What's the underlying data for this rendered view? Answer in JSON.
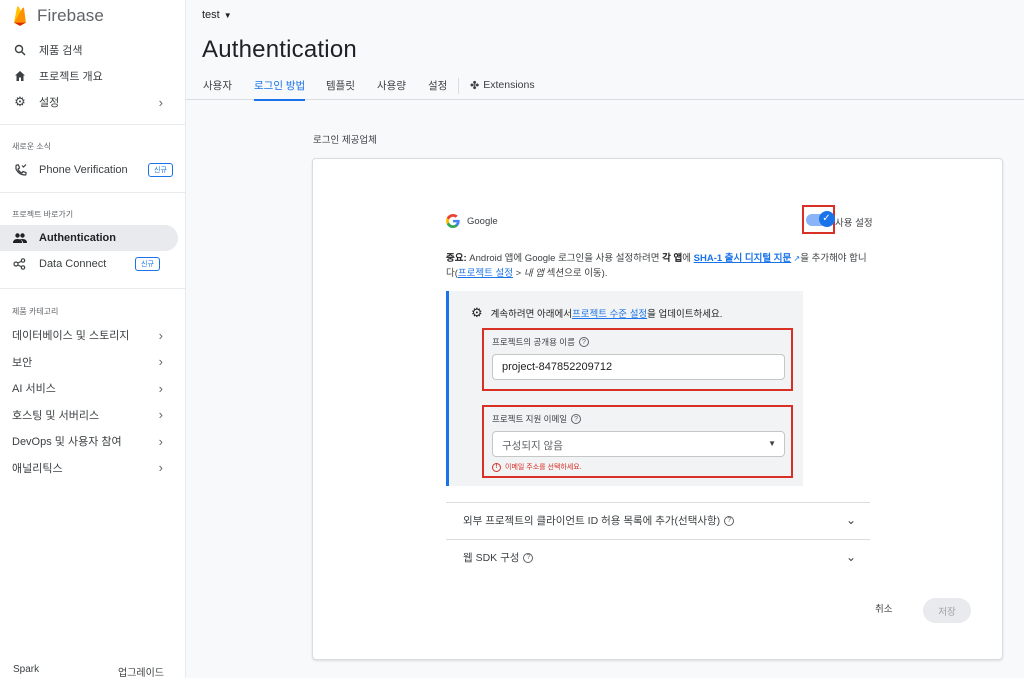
{
  "app": {
    "name": "Firebase"
  },
  "sidebar": {
    "top": [
      {
        "label": "제품 검색",
        "icon": "search-icon"
      },
      {
        "label": "프로젝트 개요",
        "icon": "home-icon"
      },
      {
        "label": "설정",
        "icon": "gear-icon"
      }
    ],
    "news_label": "새로운 소식",
    "news_item": {
      "label": "Phone Verification",
      "badge": "신규"
    },
    "shortcuts_label": "프로젝트 바로가기",
    "shortcuts": [
      {
        "label": "Authentication",
        "icon": "users-icon",
        "active": true
      },
      {
        "label": "Data Connect",
        "icon": "data-connect-icon",
        "badge": "신규"
      }
    ],
    "categories_label": "제품 카테고리",
    "categories": [
      "데이터베이스 및 스토리지",
      "보안",
      "AI 서비스",
      "호스팅 및 서버리스",
      "DevOps 및 사용자 참여",
      "애널리틱스"
    ],
    "footer": {
      "plan": "Spark",
      "upgrade": "업그레이드"
    }
  },
  "header": {
    "project": "test",
    "title": "Authentication",
    "tabs": [
      "사용자",
      "로그인 방법",
      "템플릿",
      "사용량",
      "설정",
      "Extensions"
    ],
    "active_tab": "로그인 방법"
  },
  "main": {
    "section_heading": "로그인 제공업체",
    "provider": {
      "name": "Google",
      "enabled": true,
      "enable_label": "사용 설정"
    },
    "notice": {
      "strong": "중요:",
      "text1": " Android 앱에 Google 로그인을 사용 설정하려면 ",
      "bold1": "각 앱",
      "text2": "에 ",
      "link1": "SHA-1 출시 디지털 지문",
      "text3": "을 추가해야 합니다(",
      "link2": "프로젝트 설정",
      "text4": " > ",
      "italic": "내 앱",
      "text5": " 섹션으로 이동)."
    },
    "config": {
      "title_prefix": "계속하려면 아래에서 ",
      "title_link": "프로젝트 수준 설정",
      "title_suffix": "을 업데이트하세요.",
      "public_name_label": "프로젝트의 공개용 이름",
      "public_name_value": "project-847852209712",
      "support_email_label": "프로젝트 지원 이메일",
      "support_email_value": "구성되지 않음",
      "support_email_error": "이메일 주소를 선택하세요."
    },
    "accordions": [
      "외부 프로젝트의 클라이언트 ID 허용 목록에 추가(선택사항)",
      "웹 SDK 구성"
    ],
    "actions": {
      "cancel": "취소",
      "save": "저장"
    }
  },
  "colors": {
    "accent": "#1a73e8",
    "error": "#d93025",
    "firebase_orange": "#ff9100"
  }
}
